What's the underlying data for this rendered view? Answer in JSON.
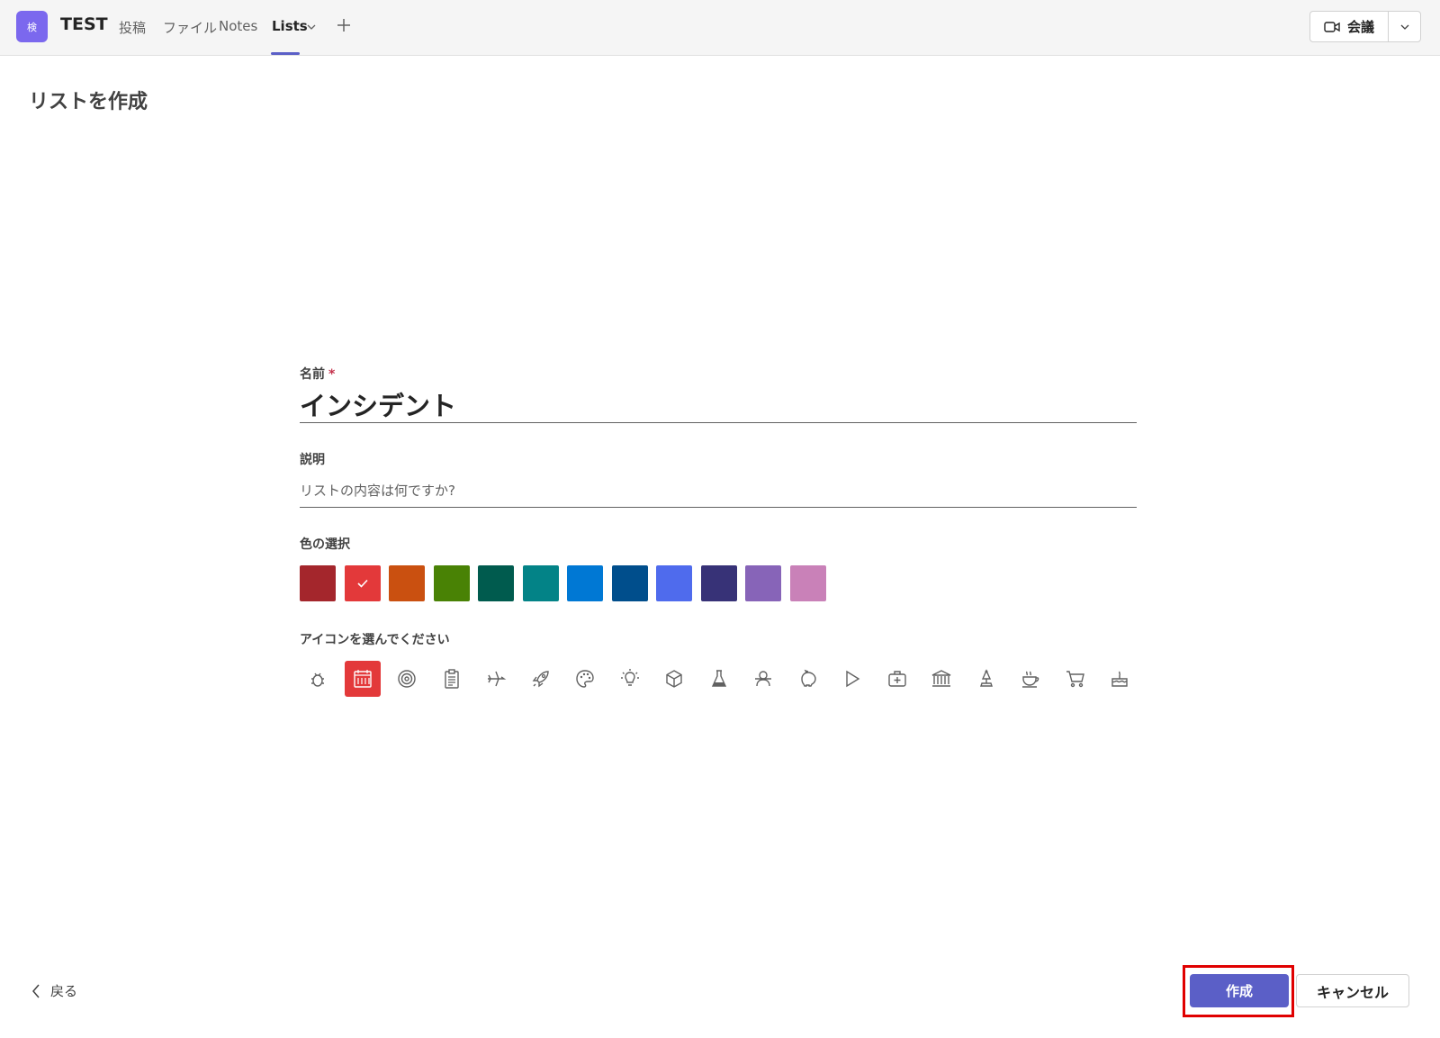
{
  "header": {
    "team_avatar_text": "検",
    "team_name": "TEST",
    "tabs": [
      {
        "label": "投稿"
      },
      {
        "label": "ファイル"
      },
      {
        "label": "Notes"
      },
      {
        "label": "Lists"
      }
    ],
    "meeting_button_label": "会議"
  },
  "page": {
    "title": "リストを作成"
  },
  "form": {
    "name_label": "名前",
    "name_required_mark": "*",
    "name_value": "インシデント",
    "description_label": "説明",
    "description_placeholder": "リストの内容は何ですか?",
    "color_label": "色の選択",
    "colors": [
      "#a4262c",
      "#e3393a",
      "#ca5010",
      "#498205",
      "#005b4e",
      "#038387",
      "#0078d4",
      "#004e8c",
      "#4f6bed",
      "#373277",
      "#8764b8",
      "#c981b8"
    ],
    "selected_color_index": 1,
    "icon_label": "アイコンを選んでください",
    "icons": [
      "bug-icon",
      "calendar-icon",
      "target-icon",
      "clipboard-icon",
      "airplane-icon",
      "rocket-icon",
      "palette-icon",
      "lightbulb-icon",
      "cube-icon",
      "beaker-icon",
      "robot-icon",
      "piggybank-icon",
      "play-icon",
      "medical-icon",
      "bank-icon",
      "trophy-icon",
      "coffee-icon",
      "cart-icon",
      "cake-icon"
    ],
    "selected_icon_index": 1
  },
  "footer": {
    "back_label": "戻る",
    "create_label": "作成",
    "cancel_label": "キャンセル"
  }
}
